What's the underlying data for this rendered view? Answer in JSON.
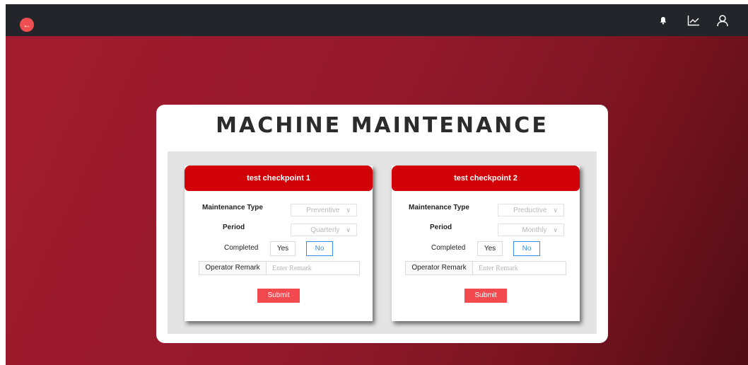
{
  "header": {
    "back_icon": "arrow-left-icon",
    "icons": [
      "bell-icon",
      "chart-line-icon",
      "user-icon"
    ]
  },
  "page": {
    "title": "MACHINE MAINTENANCE"
  },
  "checkpoints": [
    {
      "title": "test checkpoint 1",
      "maintenance_type_label": "Maintenance Type",
      "maintenance_type_value": "Preventive",
      "period_label": "Period",
      "period_value": "Quarterly",
      "completed_label": "Completed",
      "yes_label": "Yes",
      "no_label": "No",
      "remark_label": "Operator Remark",
      "remark_placeholder": "Enter Remark",
      "submit_label": "Submit"
    },
    {
      "title": "test checkpoint 2",
      "maintenance_type_label": "Maintenance Type",
      "maintenance_type_value": "Preductive",
      "period_label": "Period",
      "period_value": "Monthly",
      "completed_label": "Completed",
      "yes_label": "Yes",
      "no_label": "No",
      "remark_label": "Operator Remark",
      "remark_placeholder": "Enter Remark",
      "submit_label": "Submit"
    }
  ],
  "colors": {
    "header_bg": "#23252a",
    "accent_red": "#d10309",
    "submit_red": "#f24a4f",
    "selected_blue": "#3a8ee6"
  }
}
